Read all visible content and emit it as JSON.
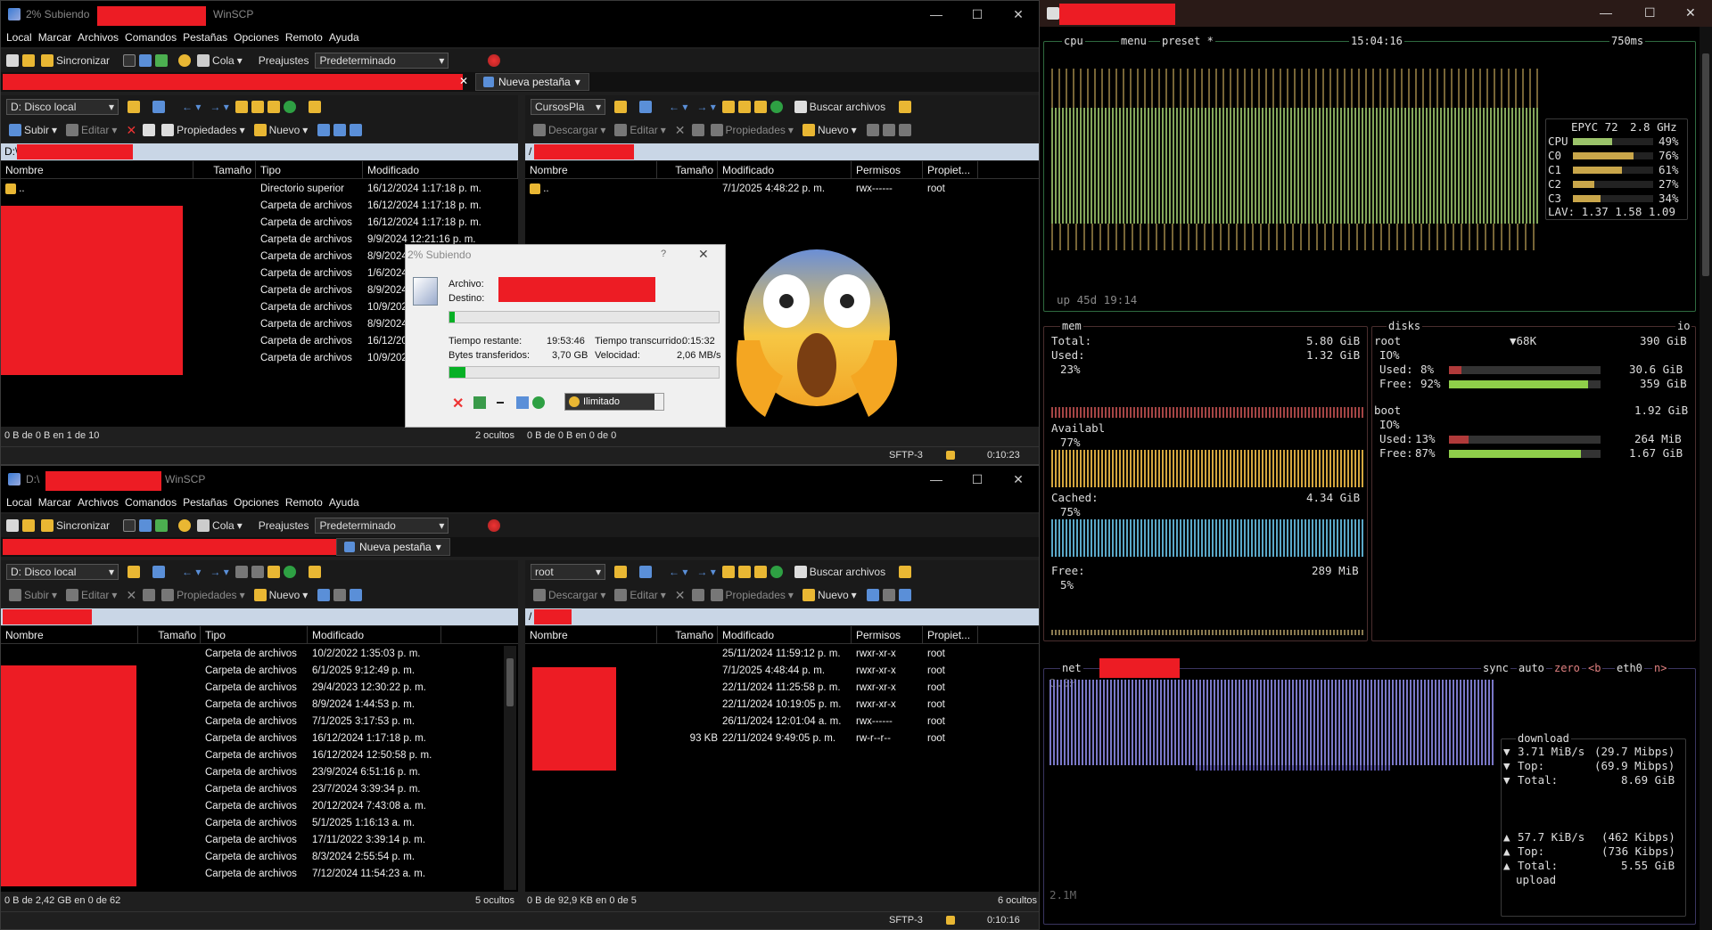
{
  "top_window": {
    "title": "2% Subiendo",
    "app": "WinSCP",
    "menu": [
      "Local",
      "Marcar",
      "Archivos",
      "Comandos",
      "Pestañas",
      "Opciones",
      "Remoto",
      "Ayuda"
    ],
    "toolbar": {
      "sync": "Sincronizar",
      "queue": "Cola",
      "presets_label": "Preajustes",
      "presets_value": "Predeterminado"
    },
    "new_tab": "Nueva pestaña",
    "left": {
      "drive": "D: Disco local",
      "upload": "Subir",
      "edit": "Editar",
      "props": "Propiedades",
      "new": "Nuevo",
      "path": "D:\\",
      "cols": [
        "Nombre",
        "Tamaño",
        "Tipo",
        "Modificado"
      ],
      "rows": [
        {
          "name": "..",
          "type": "Directorio superior",
          "mod": "16/12/2024 1:17:18 p. m."
        },
        {
          "name": "",
          "type": "Carpeta de archivos",
          "mod": "16/12/2024 1:17:18 p. m."
        },
        {
          "name": "",
          "type": "Carpeta de archivos",
          "mod": "16/12/2024 1:17:18 p. m."
        },
        {
          "name": "",
          "type": "Carpeta de archivos",
          "mod": "9/9/2024 12:21:16 p. m."
        },
        {
          "name": "",
          "type": "Carpeta de archivos",
          "mod": "8/9/2024"
        },
        {
          "name": "",
          "type": "Carpeta de archivos",
          "mod": "1/6/2024"
        },
        {
          "name": "",
          "type": "Carpeta de archivos",
          "mod": "8/9/2024"
        },
        {
          "name": "",
          "type": "Carpeta de archivos",
          "mod": "10/9/2024"
        },
        {
          "name": "",
          "type": "Carpeta de archivos",
          "mod": "8/9/2024"
        },
        {
          "name": "",
          "type": "Carpeta de archivos",
          "mod": "16/12/2024"
        },
        {
          "name": "",
          "type": "Carpeta de archivos",
          "mod": "10/9/2024"
        }
      ],
      "status": "0 B de 0 B en 1 de 10",
      "hidden": "2 ocultos"
    },
    "right": {
      "drive": "CursosPla",
      "find": "Buscar archivos",
      "download": "Descargar",
      "edit": "Editar",
      "props": "Propiedades",
      "new": "Nuevo",
      "path": "/",
      "cols": [
        "Nombre",
        "Tamaño",
        "Modificado",
        "Permisos",
        "Propiet..."
      ],
      "rows": [
        {
          "name": "..",
          "mod": "7/1/2025 4:48:22 p. m.",
          "perm": "rwx------",
          "owner": "root"
        }
      ],
      "status": "0 B de 0 B en 0 de 0",
      "proto": "SFTP-3",
      "time": "0:10:23"
    }
  },
  "dialog": {
    "title": "2% Subiendo",
    "help": "?",
    "file_label": "Archivo:",
    "dest_label": "Destino:",
    "remaining_label": "Tiempo restante:",
    "remaining": "19:53:46",
    "elapsed_label": "Tiempo transcurrido:",
    "elapsed": "0:15:32",
    "bytes_label": "Bytes transferidos:",
    "bytes": "3,70 GB",
    "speed_label": "Velocidad:",
    "speed": "2,06 MB/s",
    "speed_limit": "Ilimitado",
    "progress_file": 0.02,
    "progress_total": 0.06
  },
  "bottom_window": {
    "title": "D:\\",
    "app": "WinSCP",
    "new_tab": "Nueva pestaña",
    "left": {
      "drive": "D: Disco local",
      "upload": "Subir",
      "edit": "Editar",
      "props": "Propiedades",
      "new": "Nuevo",
      "cols": [
        "Nombre",
        "Tamaño",
        "Tipo",
        "Modificado"
      ],
      "rows": [
        {
          "type": "Carpeta de archivos",
          "mod": "10/2/2022 1:35:03 p. m."
        },
        {
          "type": "Carpeta de archivos",
          "mod": "6/1/2025 9:12:49 p. m."
        },
        {
          "type": "Carpeta de archivos",
          "mod": "29/4/2023 12:30:22 p. m."
        },
        {
          "type": "Carpeta de archivos",
          "mod": "8/9/2024 1:44:53 p. m."
        },
        {
          "type": "Carpeta de archivos",
          "mod": "7/1/2025 3:17:53 p. m."
        },
        {
          "type": "Carpeta de archivos",
          "mod": "16/12/2024 1:17:18 p. m."
        },
        {
          "type": "Carpeta de archivos",
          "mod": "16/12/2024 12:50:58 p. m."
        },
        {
          "type": "Carpeta de archivos",
          "mod": "23/9/2024 6:51:16 p. m."
        },
        {
          "type": "Carpeta de archivos",
          "mod": "23/7/2024 3:39:34 p. m."
        },
        {
          "type": "Carpeta de archivos",
          "mod": "20/12/2024 7:43:08 a. m."
        },
        {
          "type": "Carpeta de archivos",
          "mod": "5/1/2025 1:16:13 a. m."
        },
        {
          "type": "Carpeta de archivos",
          "mod": "17/11/2022 3:39:14 p. m."
        },
        {
          "type": "Carpeta de archivos",
          "mod": "8/3/2024 2:55:54 p. m."
        },
        {
          "type": "Carpeta de archivos",
          "mod": "7/12/2024 11:54:23 a. m."
        }
      ],
      "status": "0 B de 2,42 GB en 0 de 62",
      "hidden": "5 ocultos"
    },
    "right": {
      "drive": "root",
      "find": "Buscar archivos",
      "download": "Descargar",
      "edit": "Editar",
      "props": "Propiedades",
      "new": "Nuevo",
      "path": "/",
      "cols": [
        "Nombre",
        "Tamaño",
        "Modificado",
        "Permisos",
        "Propiet..."
      ],
      "rows": [
        {
          "size": "",
          "mod": "25/11/2024 11:59:12 p. m.",
          "perm": "rwxr-xr-x",
          "owner": "root"
        },
        {
          "size": "",
          "mod": "7/1/2025 4:48:44 p. m.",
          "perm": "rwxr-xr-x",
          "owner": "root"
        },
        {
          "size": "",
          "mod": "22/11/2024 11:25:58 p. m.",
          "perm": "rwxr-xr-x",
          "owner": "root"
        },
        {
          "size": "",
          "mod": "22/11/2024 10:19:05 p. m.",
          "perm": "rwxr-xr-x",
          "owner": "root"
        },
        {
          "size": "",
          "mod": "26/11/2024 12:01:04 a. m.",
          "perm": "rwx------",
          "owner": "root"
        },
        {
          "size": "93 KB",
          "mod": "22/11/2024 9:49:05 p. m.",
          "perm": "rw-r--r--",
          "owner": "root"
        }
      ],
      "status": "0 B de 92,9 KB en 0 de 5",
      "hidden": "6 ocultos",
      "proto": "SFTP-3",
      "time": "0:10:16"
    }
  },
  "btop": {
    "cpu_header": {
      "cpu": "cpu",
      "menu": "menu",
      "preset": "preset *",
      "clock": "15:04:16",
      "interval": "750ms"
    },
    "cpu_model": "EPYC 72",
    "cpu_freq": "2.8 GHz",
    "cpu_rows": [
      {
        "label": "CPU",
        "pct": "49%",
        "value": 0.49
      },
      {
        "label": "C0",
        "pct": "76%",
        "value": 0.76
      },
      {
        "label": "C1",
        "pct": "61%",
        "value": 0.61
      },
      {
        "label": "C2",
        "pct": "27%",
        "value": 0.27
      },
      {
        "label": "C3",
        "pct": "34%",
        "value": 0.34
      }
    ],
    "lav": "LAV: 1.37 1.58 1.09",
    "uptime": "up 45d 19:14",
    "mem": {
      "label": "mem",
      "total_label": "Total:",
      "total": "5.80 GiB",
      "used_label": "Used:",
      "used": "1.32 GiB",
      "used_pct": "23%",
      "avail_label": "Availabl",
      "avail_pct": "77%",
      "cached_label": "Cached:",
      "cached": "4.34 GiB",
      "cached_pct": "75%",
      "free_label": "Free:",
      "free": "289 MiB",
      "free_pct": "5%"
    },
    "disks": {
      "label": "disks",
      "io": "io",
      "root": {
        "name": "root",
        "io_rate": "▼68K",
        "size": "390 GiB",
        "io": "IO%",
        "used_label": "Used:",
        "used_pct": "8%",
        "used": "30.6 GiB",
        "free_label": "Free:",
        "free_pct": "92%",
        "free": "359 GiB",
        "used_v": 0.08,
        "free_v": 0.92
      },
      "boot": {
        "name": "boot",
        "size": "1.92 GiB",
        "io": "IO%",
        "used_label": "Used:",
        "used_pct": "13%",
        "used": "264 MiB",
        "free_label": "Free:",
        "free_pct": "87%",
        "free": "1.67 GiB",
        "used_v": 0.13,
        "free_v": 0.87
      }
    },
    "net": {
      "label": "net",
      "sync": "sync",
      "auto": "auto",
      "zero": "zero",
      "iface_prev": "<b",
      "iface": "eth0",
      "iface_next": "n>",
      "scale_top": "2.1M",
      "scale_bottom": "2.1M",
      "download": "download",
      "dl_rate": "3.71 MiB/s",
      "dl_rate_bits": "(29.7 Mibps)",
      "dl_top_label": "Top:",
      "dl_top": "(69.9 Mibps)",
      "dl_total_label": "Total:",
      "dl_total": "8.69 GiB",
      "ul_rate": "57.7 KiB/s",
      "ul_rate_bits": "(462 Kibps)",
      "ul_top_label": "Top:",
      "ul_top": "(736 Kibps)",
      "ul_total_label": "Total:",
      "ul_total": "5.55 GiB",
      "upload": "upload"
    }
  }
}
